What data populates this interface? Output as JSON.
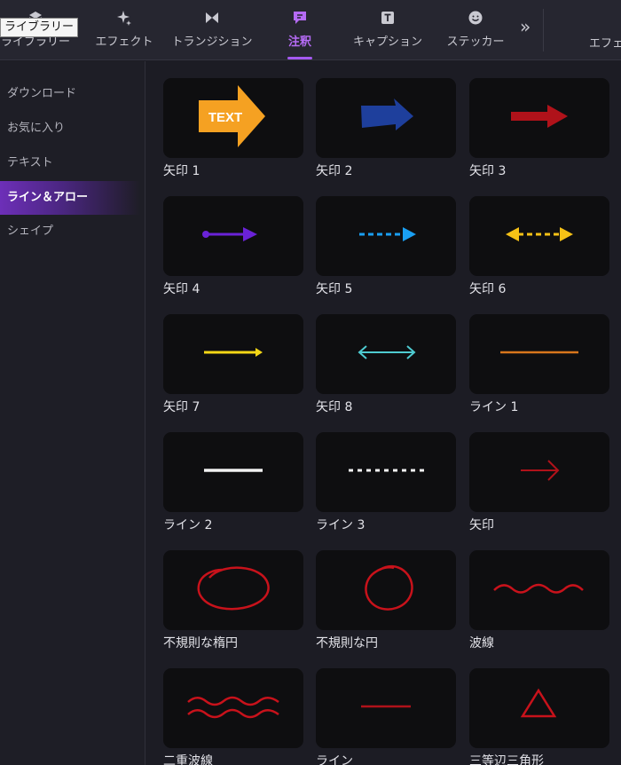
{
  "tooltip": "ライブラリー",
  "tabs": [
    {
      "label": "ライブラリー",
      "icon": "library-icon"
    },
    {
      "label": "エフェクト",
      "icon": "sparkle-icon"
    },
    {
      "label": "トランジション",
      "icon": "transition-icon"
    },
    {
      "label": "注釈",
      "icon": "annotation-icon"
    },
    {
      "label": "キャプション",
      "icon": "caption-icon"
    },
    {
      "label": "ステッカー",
      "icon": "sticker-icon"
    }
  ],
  "more_icon": "chevron-double-right-icon",
  "right_tab_label": "エフェクト",
  "sidebar": {
    "items": [
      {
        "label": "ダウンロード"
      },
      {
        "label": "お気に入り"
      },
      {
        "label": "テキスト"
      },
      {
        "label": "ライン＆アロー"
      },
      {
        "label": "シェイプ"
      }
    ]
  },
  "accent_color": "#a459f0",
  "items": [
    {
      "label": "矢印 1",
      "thumb_text": "TEXT"
    },
    {
      "label": "矢印 2"
    },
    {
      "label": "矢印 3"
    },
    {
      "label": "矢印 4"
    },
    {
      "label": "矢印 5"
    },
    {
      "label": "矢印 6"
    },
    {
      "label": "矢印 7"
    },
    {
      "label": "矢印 8"
    },
    {
      "label": "ライン 1"
    },
    {
      "label": "ライン 2"
    },
    {
      "label": "ライン 3"
    },
    {
      "label": "矢印"
    },
    {
      "label": "不規則な楕円"
    },
    {
      "label": "不規則な円"
    },
    {
      "label": "波線"
    },
    {
      "label": "二重波線"
    },
    {
      "label": "ライン"
    },
    {
      "label": "三等辺三角形"
    }
  ]
}
